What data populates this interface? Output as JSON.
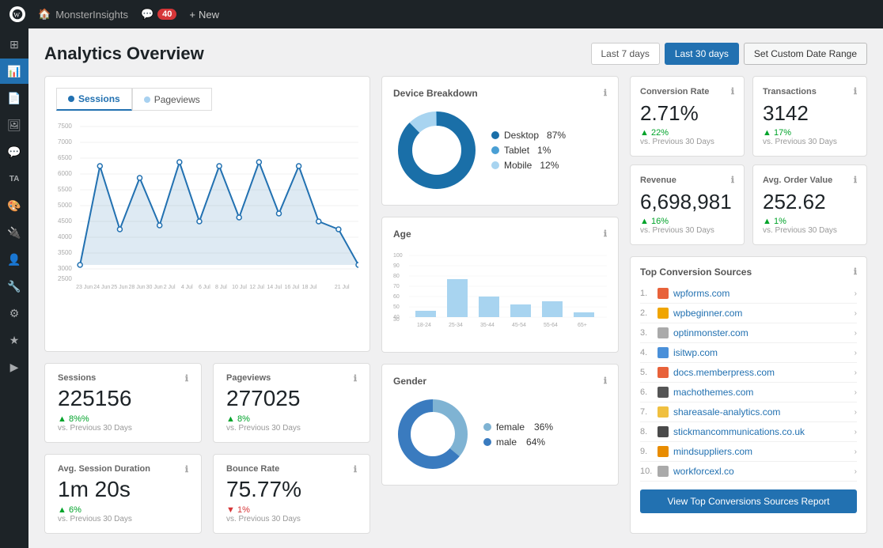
{
  "topbar": {
    "site_name": "MonsterInsights",
    "comments_count": "40",
    "new_label": "New"
  },
  "header": {
    "title": "Analytics Overview",
    "date_btn_7": "Last 7 days",
    "date_btn_30": "Last 30 days",
    "date_btn_custom": "Set Custom Date Range"
  },
  "chart": {
    "tab_sessions": "Sessions",
    "tab_pageviews": "Pageviews"
  },
  "device_breakdown": {
    "title": "Device Breakdown",
    "desktop_label": "Desktop",
    "desktop_pct": "87%",
    "tablet_label": "Tablet",
    "tablet_pct": "1%",
    "mobile_label": "Mobile",
    "mobile_pct": "12%"
  },
  "age": {
    "title": "Age",
    "labels": [
      "18-24",
      "25-34",
      "35-44",
      "45-54",
      "55-64",
      "65+"
    ]
  },
  "gender": {
    "title": "Gender",
    "female_label": "female",
    "female_pct": "36%",
    "male_label": "male",
    "male_pct": "64%"
  },
  "stats": {
    "sessions_label": "Sessions",
    "sessions_value": "225156",
    "sessions_change": "8%%",
    "sessions_sub": "vs. Previous 30 Days",
    "pageviews_label": "Pageviews",
    "pageviews_value": "277025",
    "pageviews_change": "8%",
    "pageviews_sub": "vs. Previous 30 Days",
    "avg_session_label": "Avg. Session Duration",
    "avg_session_value": "1m 20s",
    "avg_session_change": "6%",
    "avg_session_sub": "vs. Previous 30 Days",
    "bounce_label": "Bounce Rate",
    "bounce_value": "75.77%",
    "bounce_change": "1%",
    "bounce_sub": "vs. Previous 30 Days"
  },
  "conversion": {
    "rate_label": "Conversion Rate",
    "rate_value": "2.71%",
    "rate_change": "22%",
    "rate_sub": "vs. Previous 30 Days",
    "transactions_label": "Transactions",
    "transactions_value": "3142",
    "transactions_change": "17%",
    "transactions_sub": "vs. Previous 30 Days",
    "revenue_label": "Revenue",
    "revenue_value": "6,698,981",
    "revenue_change": "16%",
    "revenue_sub": "vs. Previous 30 Days",
    "avg_order_label": "Avg. Order Value",
    "avg_order_value": "252.62",
    "avg_order_change": "1%",
    "avg_order_sub": "vs. Previous 30 Days"
  },
  "top_sources": {
    "title": "Top Conversion Sources",
    "view_btn": "View Top Conversions Sources Report",
    "sources": [
      {
        "num": "1.",
        "name": "wpforms.com",
        "color": "#e8623a"
      },
      {
        "num": "2.",
        "name": "wpbeginner.com",
        "color": "#f0a500"
      },
      {
        "num": "3.",
        "name": "optinmonster.com",
        "color": "#aaa"
      },
      {
        "num": "4.",
        "name": "isitwp.com",
        "color": "#4a90d9"
      },
      {
        "num": "5.",
        "name": "docs.memberpress.com",
        "color": "#e8623a"
      },
      {
        "num": "6.",
        "name": "machothemes.com",
        "color": "#555"
      },
      {
        "num": "7.",
        "name": "shareasale-analytics.com",
        "color": "#f0c040"
      },
      {
        "num": "8.",
        "name": "stickmancommunications.co.uk",
        "color": "#4a4a4a"
      },
      {
        "num": "9.",
        "name": "mindsuppliers.com",
        "color": "#e88c00"
      },
      {
        "num": "10.",
        "name": "workforcexl.co",
        "color": "#aaa"
      }
    ]
  }
}
